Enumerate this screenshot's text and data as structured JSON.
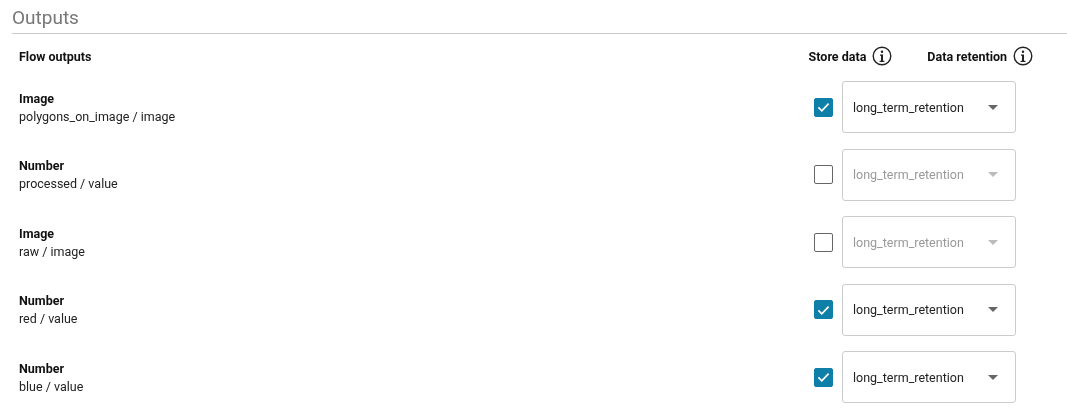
{
  "section_title": "Outputs",
  "columns": {
    "outputs": "Flow outputs",
    "store": "Store data",
    "retention": "Data retention"
  },
  "rows": [
    {
      "type": "Image",
      "path": "polygons_on_image / image",
      "store_data": true,
      "retention": "long_term_retention",
      "disabled": false
    },
    {
      "type": "Number",
      "path": "processed / value",
      "store_data": false,
      "retention": "long_term_retention",
      "disabled": true
    },
    {
      "type": "Image",
      "path": "raw / image",
      "store_data": false,
      "retention": "long_term_retention",
      "disabled": true
    },
    {
      "type": "Number",
      "path": "red / value",
      "store_data": true,
      "retention": "long_term_retention",
      "disabled": false
    },
    {
      "type": "Number",
      "path": "blue / value",
      "store_data": true,
      "retention": "long_term_retention",
      "disabled": false
    }
  ]
}
